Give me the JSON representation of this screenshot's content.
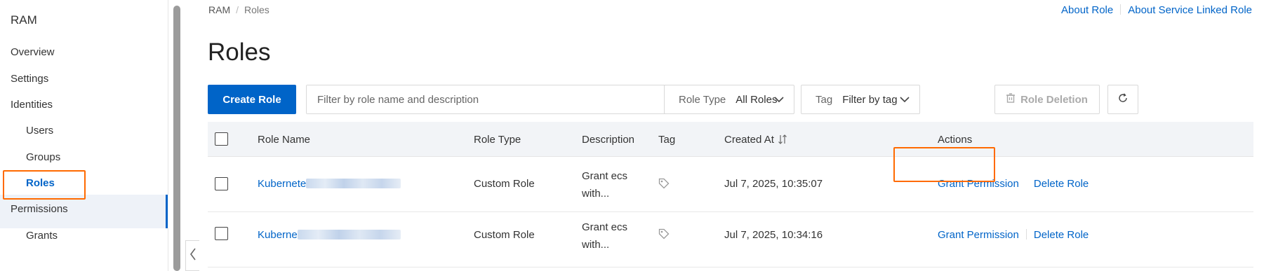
{
  "sidebar": {
    "title": "RAM",
    "items": [
      {
        "label": "Overview"
      },
      {
        "label": "Settings"
      },
      {
        "label": "Identities"
      },
      {
        "label": "Users"
      },
      {
        "label": "Groups"
      },
      {
        "label": "Roles"
      },
      {
        "label": "Permissions"
      },
      {
        "label": "Grants"
      }
    ]
  },
  "breadcrumb": {
    "root": "RAM",
    "separator": "/",
    "current": "Roles"
  },
  "top_links": {
    "about_role": "About Role",
    "about_slr": "About Service Linked Role"
  },
  "page_title": "Roles",
  "toolbar": {
    "create_role": "Create Role",
    "search_placeholder": "Filter by role name and description",
    "role_type_label": "Role Type",
    "role_type_value": "All Roles",
    "tag_label": "Tag",
    "tag_value": "Filter by tag",
    "role_deletion": "Role Deletion"
  },
  "table": {
    "columns": {
      "name": "Role Name",
      "type": "Role Type",
      "description": "Description",
      "tag": "Tag",
      "created": "Created At",
      "actions": "Actions"
    },
    "rows": [
      {
        "name": "Kubernete",
        "type": "Custom Role",
        "desc1": "Grant ecs",
        "desc2": "with...",
        "created": "Jul 7, 2025, 10:35:07",
        "grant": "Grant Permission",
        "delete": "Delete Role"
      },
      {
        "name": "Kuberne",
        "type": "Custom Role",
        "desc1": "Grant ecs",
        "desc2": "with...",
        "created": "Jul 7, 2025, 10:34:16",
        "grant": "Grant Permission",
        "delete": "Delete Role"
      }
    ]
  },
  "colors": {
    "accent": "#0064c8",
    "highlight": "#ff6a00"
  }
}
